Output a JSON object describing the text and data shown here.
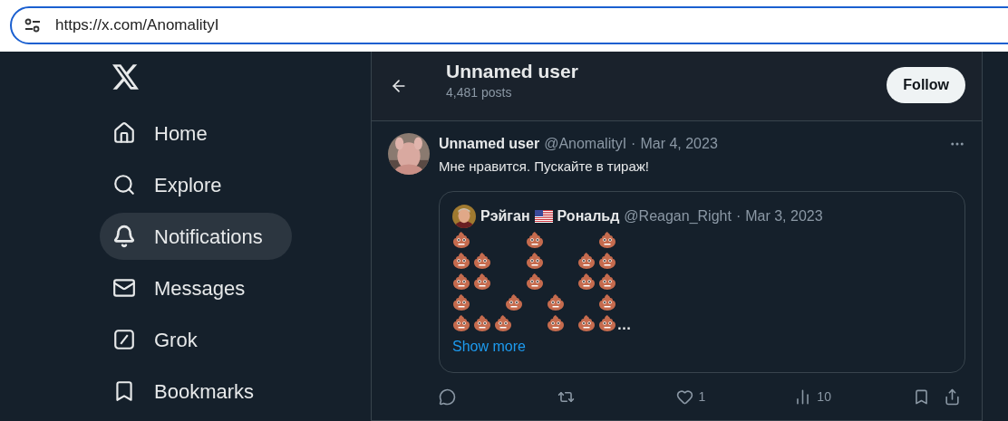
{
  "address_bar": {
    "url": "https://x.com/AnomalityI"
  },
  "sidebar": {
    "items": [
      {
        "kind": "home",
        "label": "Home",
        "selected": false
      },
      {
        "kind": "explore",
        "label": "Explore",
        "selected": false
      },
      {
        "kind": "notifications",
        "label": "Notifications",
        "selected": true
      },
      {
        "kind": "messages",
        "label": "Messages",
        "selected": false
      },
      {
        "kind": "grok",
        "label": "Grok",
        "selected": false
      },
      {
        "kind": "bookmarks",
        "label": "Bookmarks",
        "selected": false
      }
    ]
  },
  "header": {
    "title": "Unnamed user",
    "subtitle": "4,481 posts",
    "follow_button": "Follow"
  },
  "post": {
    "author": "Unnamed user",
    "handle": "@AnomalityI",
    "separator": "·",
    "date": "Mar 4, 2023",
    "text": "Мне нравится. Пускайте в тираж!",
    "quote": {
      "name_before_flag": "Рэйган",
      "name_after_flag": "Рональд",
      "handle": "@Reagan_Right",
      "separator": "·",
      "date": "Mar 3, 2023",
      "emoji_rows": [
        {
          "cells": [
            true,
            false,
            false,
            false,
            false,
            false,
            false,
            true,
            false,
            false,
            false,
            false,
            false,
            false,
            true
          ]
        },
        {
          "cells": [
            true,
            false,
            true,
            false,
            false,
            false,
            false,
            true,
            false,
            false,
            false,
            false,
            true,
            false,
            true
          ]
        },
        {
          "cells": [
            true,
            false,
            true,
            false,
            false,
            false,
            false,
            true,
            false,
            false,
            false,
            false,
            true,
            false,
            true
          ]
        },
        {
          "cells": [
            true,
            false,
            false,
            false,
            false,
            true,
            false,
            false,
            false,
            true,
            false,
            false,
            false,
            false,
            true
          ]
        },
        {
          "cells": [
            true,
            false,
            true,
            false,
            true,
            false,
            false,
            false,
            false,
            true,
            false,
            false,
            true,
            false,
            true
          ]
        }
      ],
      "ellipsis": "…",
      "show_more": "Show more"
    },
    "actions": [
      {
        "kind": "reply"
      },
      {
        "kind": "repost"
      },
      {
        "kind": "like",
        "count": "1"
      },
      {
        "kind": "views",
        "count": "10"
      },
      {
        "kind": "bookmark"
      },
      {
        "kind": "share"
      }
    ]
  }
}
